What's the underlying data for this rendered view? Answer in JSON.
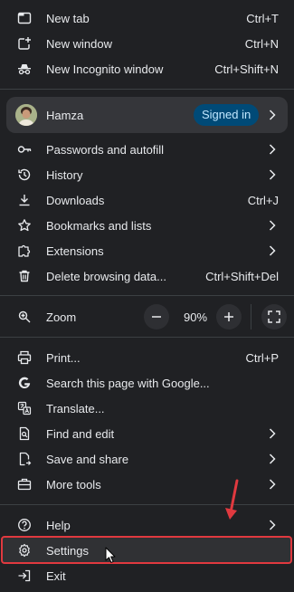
{
  "menu": {
    "new_tab": {
      "label": "New tab",
      "shortcut": "Ctrl+T",
      "icon": "new-tab-icon"
    },
    "new_window": {
      "label": "New window",
      "shortcut": "Ctrl+N",
      "icon": "new-window-icon"
    },
    "new_incognito": {
      "label": "New Incognito window",
      "shortcut": "Ctrl+Shift+N",
      "icon": "incognito-icon"
    },
    "profile": {
      "name": "Hamza",
      "status": "Signed in"
    },
    "passwords": {
      "label": "Passwords and autofill",
      "icon": "key-icon"
    },
    "history": {
      "label": "History",
      "icon": "history-icon"
    },
    "downloads": {
      "label": "Downloads",
      "shortcut": "Ctrl+J",
      "icon": "download-icon"
    },
    "bookmarks": {
      "label": "Bookmarks and lists",
      "icon": "star-icon"
    },
    "extensions": {
      "label": "Extensions",
      "icon": "puzzle-icon"
    },
    "delete_data": {
      "label": "Delete browsing data...",
      "shortcut": "Ctrl+Shift+Del",
      "icon": "trash-icon"
    },
    "zoom": {
      "label": "Zoom",
      "value": "90%",
      "icon": "zoom-icon"
    },
    "print": {
      "label": "Print...",
      "shortcut": "Ctrl+P",
      "icon": "printer-icon"
    },
    "search_google": {
      "label": "Search this page with Google...",
      "icon": "google-icon"
    },
    "translate": {
      "label": "Translate...",
      "icon": "translate-icon"
    },
    "find_edit": {
      "label": "Find and edit",
      "icon": "find-icon"
    },
    "save_share": {
      "label": "Save and share",
      "icon": "save-share-icon"
    },
    "more_tools": {
      "label": "More tools",
      "icon": "toolbox-icon"
    },
    "help": {
      "label": "Help",
      "icon": "help-icon"
    },
    "settings": {
      "label": "Settings",
      "icon": "gear-icon"
    },
    "exit": {
      "label": "Exit",
      "icon": "exit-icon"
    }
  },
  "colors": {
    "background": "#202124",
    "text": "#e8eaed",
    "separator": "#3c4043",
    "badge_bg": "#004a77",
    "badge_text": "#c2e7ff",
    "highlight_border": "#e0393f"
  }
}
